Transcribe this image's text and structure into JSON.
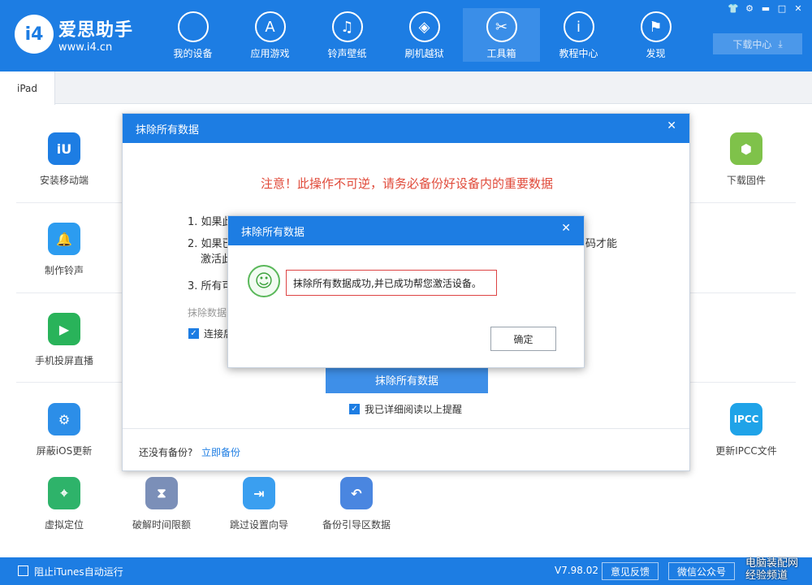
{
  "app": {
    "name": "爱思助手",
    "url": "www.i4.cn",
    "logo_text": "i4"
  },
  "nav": [
    {
      "label": "我的设备",
      "icon": "apple-icon",
      "glyph": ""
    },
    {
      "label": "应用游戏",
      "icon": "appstore-icon",
      "glyph": "A"
    },
    {
      "label": "铃声壁纸",
      "icon": "music-icon",
      "glyph": "♫"
    },
    {
      "label": "刷机越狱",
      "icon": "box-icon",
      "glyph": "◈"
    },
    {
      "label": "工具箱",
      "icon": "tools-icon",
      "glyph": "✂"
    },
    {
      "label": "教程中心",
      "icon": "info-icon",
      "glyph": "i"
    },
    {
      "label": "发现",
      "icon": "flag-icon",
      "glyph": "⚑"
    }
  ],
  "window_controls": [
    "👕",
    "⚙",
    "▬",
    "□",
    "✕"
  ],
  "download_label": "下载中心",
  "download_glyph": "⤓",
  "tab": "iPad",
  "tools": {
    "install": "安装移动端",
    "ringtone": "制作铃声",
    "mirror": "手机投屏直播",
    "block_update": "屏蔽iOS更新",
    "firmware": "下载固件",
    "ipcc": "更新IPCC文件",
    "location": "虚拟定位",
    "screen_time": "破解时间限额",
    "skip_setup": "跳过设置向导",
    "backup_boot": "备份引导区数据"
  },
  "tool_glyphs": {
    "install": "iU",
    "ringtone": "🔔",
    "mirror": "▶",
    "block_update": "⚙",
    "firmware": "⬢",
    "ipcc": "IPCC",
    "location": "⌖",
    "screen_time": "⧗",
    "skip_setup": "⇥",
    "backup_boot": "↶"
  },
  "dialog1": {
    "title": "抹除所有数据",
    "close_glyph": "✕",
    "warning": "注意！此操作不可逆，请务必备份好设备内的重要数据",
    "item1": "1. 如果此",
    "item2a": "2. 如果已",
    "item2b": "激活此",
    "item2_tail": "码才能",
    "item3": "3. 所有可",
    "erase_hint": "抹除数据",
    "connect_label": "连接后",
    "erase_button": "抹除所有数据",
    "confirm_read": "我已详细阅读以上提醒",
    "no_backup": "还没有备份?",
    "backup_now": "立即备份"
  },
  "dialog2": {
    "title": "抹除所有数据",
    "close_glyph": "✕",
    "message": "抹除所有数据成功,并已成功帮您激活设备。",
    "ok": "确定"
  },
  "status": {
    "block_itunes": "阻止iTunes自动运行",
    "version": "V7.98.02",
    "feedback": "意见反馈",
    "wechat": "微信公众号",
    "watermark1": "电脑装配网",
    "watermark2": "经验频道"
  },
  "colors": {
    "brand": "#1d7de3",
    "warning": "#e04a3a",
    "success": "#5ab85a"
  }
}
